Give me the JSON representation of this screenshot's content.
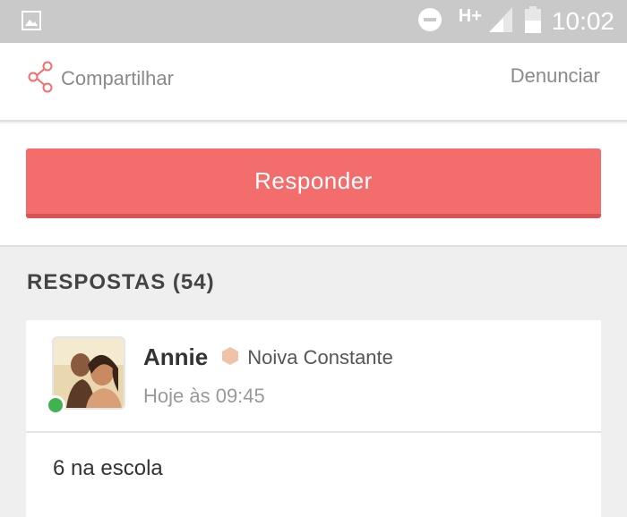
{
  "status_bar": {
    "network": "H+",
    "time": "10:02",
    "icons": [
      "gallery-icon",
      "do-not-disturb-icon",
      "signal-icon",
      "battery-icon"
    ]
  },
  "actions": {
    "share_label": "Compartilhar",
    "report_label": "Denunciar",
    "share_icon": "share-icon"
  },
  "reply": {
    "label": "Responder"
  },
  "answers": {
    "title": "RESPOSTAS (54)",
    "items": [
      {
        "author": "Annie",
        "rank": "Noiva Constante",
        "time": "Hoje às 09:45",
        "text": "6 na escola",
        "online": true
      }
    ]
  },
  "colors": {
    "accent": "#f46d6d",
    "status_bar": "#c9c9c9",
    "online": "#3fb34f",
    "rank_badge": "#f0c2a8"
  }
}
